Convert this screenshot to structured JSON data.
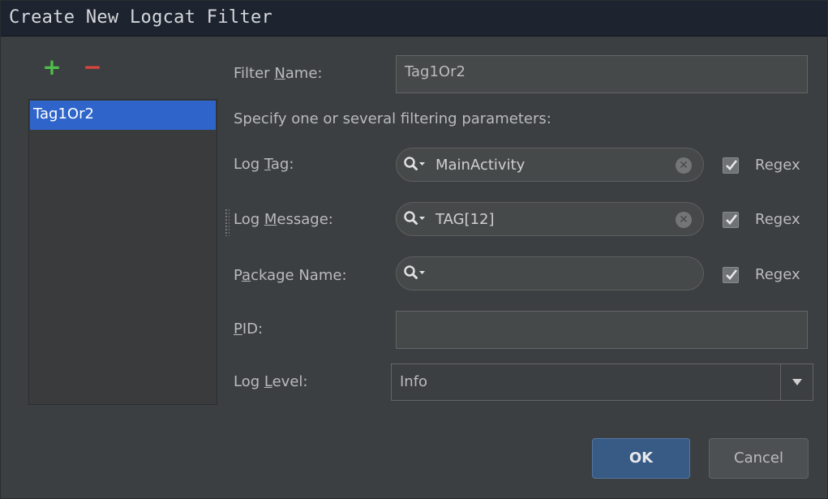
{
  "dialog": {
    "title": "Create New Logcat Filter"
  },
  "toolbar": {
    "add_label": "+",
    "remove_label": "−"
  },
  "filter_list": {
    "items": [
      {
        "label": "Tag1Or2",
        "selected": true
      }
    ]
  },
  "form": {
    "filter_name": {
      "label_pre": "Filter ",
      "label_mnemonic": "N",
      "label_post": "ame:",
      "value": "Tag1Or2"
    },
    "hint": "Specify one or several filtering parameters:",
    "log_tag": {
      "label_pre": "Log ",
      "label_mnemonic": "T",
      "label_post": "ag:",
      "value": "MainActivity",
      "regex_checked": true
    },
    "log_message": {
      "label_pre": "Log ",
      "label_mnemonic": "M",
      "label_post": "essage:",
      "value": "TAG[12]",
      "regex_checked": true
    },
    "package_name": {
      "label_pre": "P",
      "label_mnemonic": "a",
      "label_post": "ckage Name:",
      "value": "",
      "regex_checked": true
    },
    "pid": {
      "label_pre": "",
      "label_mnemonic": "P",
      "label_post": "ID:",
      "value": ""
    },
    "log_level": {
      "label_pre": "Log ",
      "label_mnemonic": "L",
      "label_post": "evel:",
      "value": "Info"
    },
    "regex_label": "Regex"
  },
  "buttons": {
    "ok_label": "OK",
    "cancel_label": "Cancel"
  },
  "colors": {
    "selection": "#2f65ca",
    "add": "#4fbf4b",
    "remove": "#d9453d",
    "ok_button": "#375b85"
  },
  "icons": {
    "add": "plus-icon",
    "remove": "minus-icon",
    "search": "search-icon",
    "clear": "clear-icon",
    "checkbox": "check-icon",
    "dropdown": "chevron-down-icon"
  }
}
